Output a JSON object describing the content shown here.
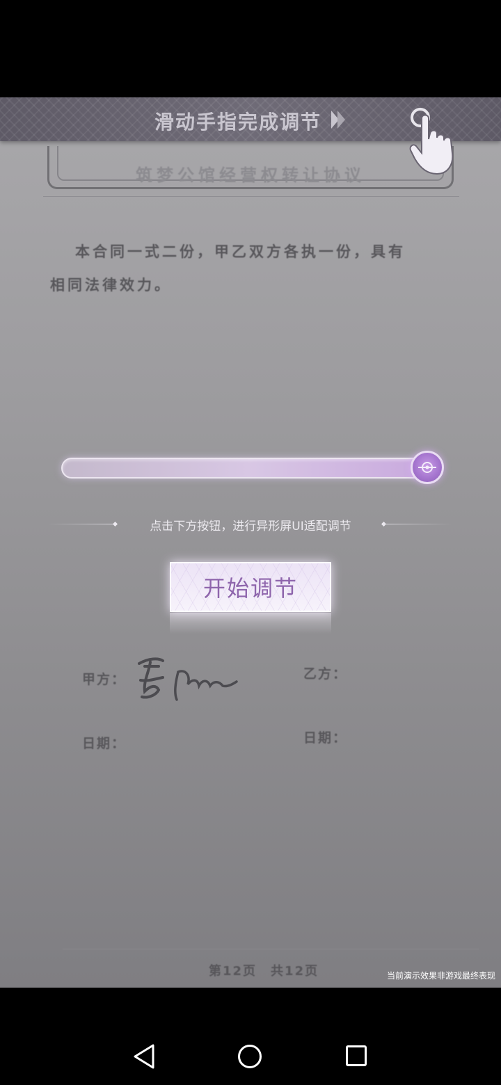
{
  "banner": {
    "title": "滑动手指完成调节",
    "icons": [
      "play-arrow-icon",
      "target-ring-icon",
      "tap-hand-icon"
    ]
  },
  "document": {
    "title": "筑梦公馆经营权转让协议",
    "paragraph_line1": "本合同一式二份，甲乙双方各执一份，具有",
    "paragraph_line2": "相同法律效力。",
    "party_a_label": "甲方：",
    "party_b_label": "乙方：",
    "date_label_a": "日期：",
    "date_label_b": "日期：",
    "page_indicator": "第12页　共12页"
  },
  "slider": {
    "value_fraction": 1.0,
    "thumb_icon": "adjust-handle-icon"
  },
  "hint": {
    "text": "点击下方按钮，进行异形屏UI适配调节"
  },
  "start_button": {
    "label": "开始调节"
  },
  "disclaimer": "当前演示效果非游戏最终表现",
  "navbar": {
    "icons": [
      "back-triangle-icon",
      "home-circle-icon",
      "recent-apps-square-icon"
    ]
  },
  "colors": {
    "accent_purple": "#8e65ac",
    "slider_thumb": "#a676cf",
    "background_gray": "#9c9b9e"
  }
}
